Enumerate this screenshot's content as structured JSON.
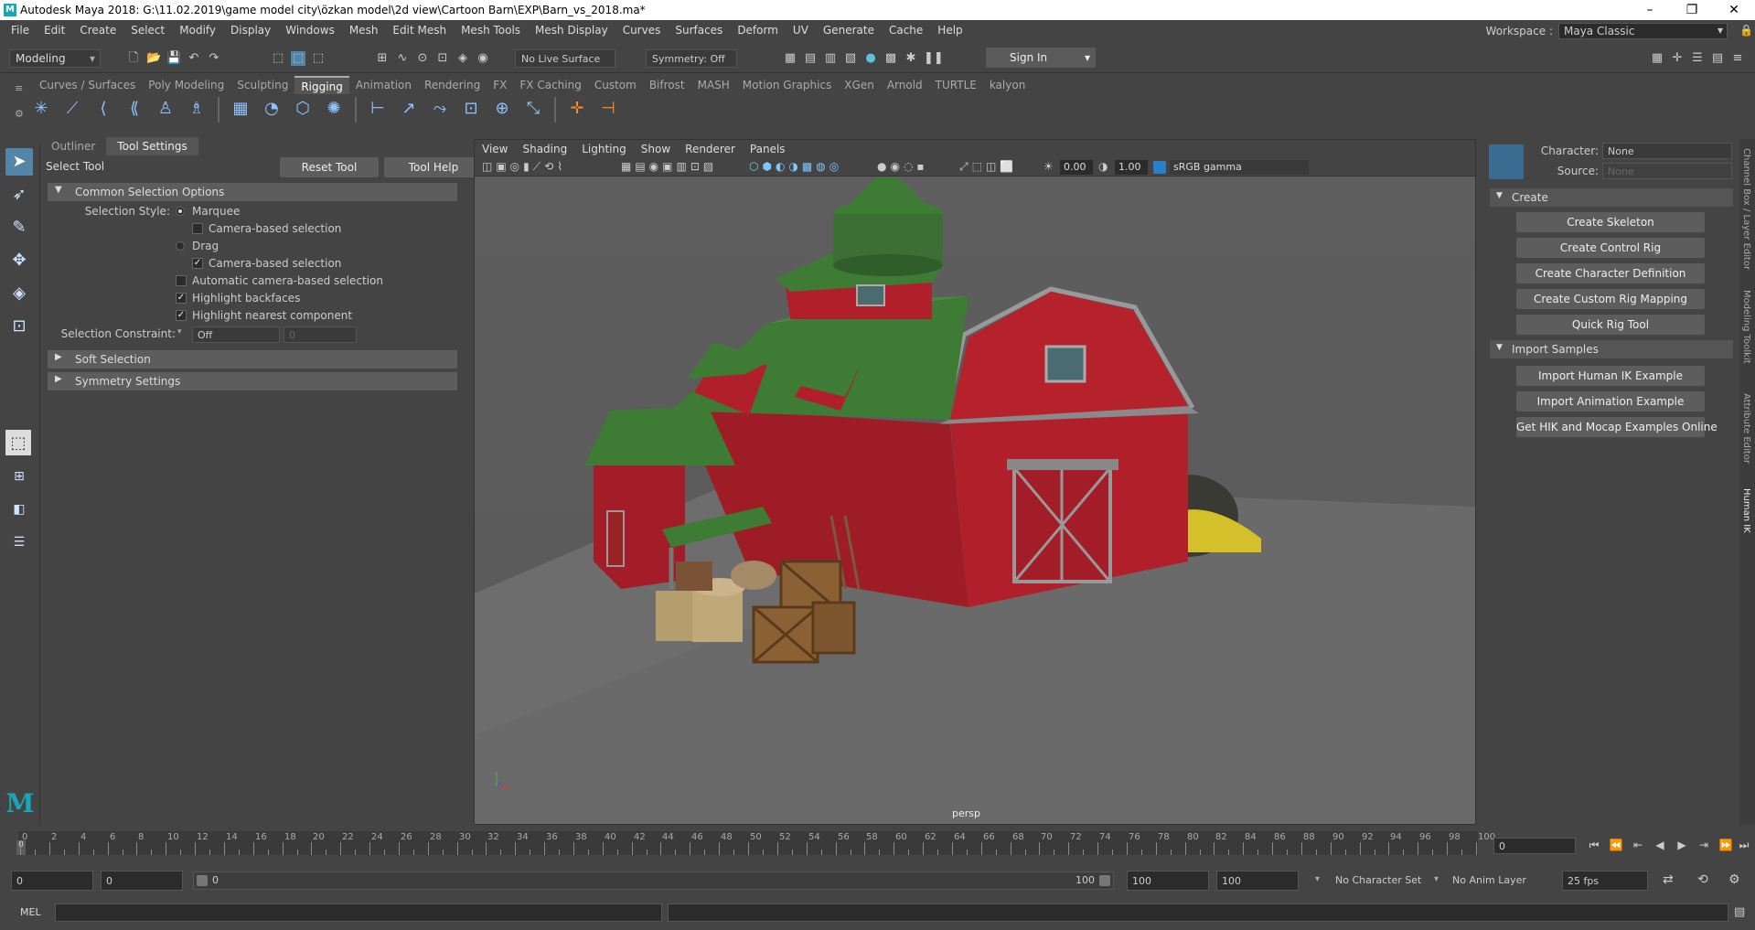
{
  "window": {
    "title": "Autodesk Maya 2018: G:\\11.02.2019\\game model city\\özkan model\\2d view\\Cartoon Barn\\EXP\\Barn_vs_2018.ma*",
    "logo": "M",
    "minimize": "–",
    "maximize": "❐",
    "close": "✕"
  },
  "menubar": {
    "items": [
      "File",
      "Edit",
      "Create",
      "Select",
      "Modify",
      "Display",
      "Windows",
      "Mesh",
      "Edit Mesh",
      "Mesh Tools",
      "Mesh Display",
      "Curves",
      "Surfaces",
      "Deform",
      "UV",
      "Generate",
      "Cache",
      "Help"
    ],
    "workspace_label": "Workspace :",
    "workspace_value": "Maya Classic"
  },
  "statusline": {
    "mode": "Modeling",
    "live_surface": "No Live Surface",
    "symmetry": "Symmetry: Off",
    "sign_in": "Sign In"
  },
  "shelf": {
    "tabs": [
      "Curves / Surfaces",
      "Poly Modeling",
      "Sculpting",
      "Rigging",
      "Animation",
      "Rendering",
      "FX",
      "FX Caching",
      "Custom",
      "Bifrost",
      "MASH",
      "Motion Graphics",
      "XGen",
      "Arnold",
      "TURTLE",
      "kalyon"
    ],
    "active_tab": "Rigging"
  },
  "leftpanel": {
    "tabs": [
      "Outliner",
      "Tool Settings"
    ],
    "tool_name": "Select Tool",
    "reset_tool": "Reset Tool",
    "tool_help": "Tool Help",
    "common_selection": "Common Selection Options",
    "selection_style_label": "Selection Style:",
    "marquee": "Marquee",
    "camera_based_1": "Camera-based selection",
    "drag": "Drag",
    "camera_based_2": "Camera-based selection",
    "auto_camera": "Automatic camera-based selection",
    "highlight_backfaces": "Highlight backfaces",
    "highlight_nearest": "Highlight nearest component",
    "constraint_label": "Selection Constraint:",
    "constraint_value": "Off",
    "constraint_num": "0",
    "soft_selection": "Soft Selection",
    "symmetry_settings": "Symmetry Settings"
  },
  "viewport": {
    "menu": [
      "View",
      "Shading",
      "Lighting",
      "Show",
      "Renderer",
      "Panels"
    ],
    "field1": "0.00",
    "field2": "1.00",
    "colorspace": "sRGB gamma",
    "camera": "persp"
  },
  "rightpanel": {
    "character_label": "Character:",
    "character_value": "None",
    "source_label": "Source:",
    "source_value": "None",
    "create_section": "Create",
    "create_buttons": [
      "Create Skeleton",
      "Create Control Rig",
      "Create Character Definition",
      "Create Custom Rig Mapping",
      "Quick Rig Tool"
    ],
    "import_section": "Import Samples",
    "import_buttons": [
      "Import Human IK Example",
      "Import Animation Example",
      "Get HIK and Mocap Examples Online"
    ],
    "side_tabs": [
      "Channel Box / Layer Editor",
      "Modeling Toolkit",
      "Attribute Editor",
      "Human IK"
    ]
  },
  "timeline": {
    "tick_labels": [
      "0",
      "2",
      "4",
      "6",
      "8",
      "10",
      "12",
      "14",
      "16",
      "18",
      "20",
      "22",
      "24",
      "26",
      "28",
      "30",
      "32",
      "34",
      "36",
      "38",
      "40",
      "42",
      "44",
      "46",
      "48",
      "50",
      "52",
      "54",
      "56",
      "58",
      "60",
      "62",
      "64",
      "66",
      "68",
      "70",
      "72",
      "74",
      "76",
      "78",
      "80",
      "82",
      "84",
      "86",
      "88",
      "90",
      "92",
      "94",
      "96",
      "98",
      "100"
    ],
    "current_frame": "0",
    "current_marker": "0"
  },
  "range": {
    "start": "0",
    "inner_start": "0",
    "slider_start": "0",
    "slider_end": "100",
    "inner_end": "100",
    "end": "100",
    "character_set": "No Character Set",
    "anim_layer": "No Anim Layer",
    "fps": "25 fps"
  },
  "cmdline": {
    "label": "MEL"
  }
}
